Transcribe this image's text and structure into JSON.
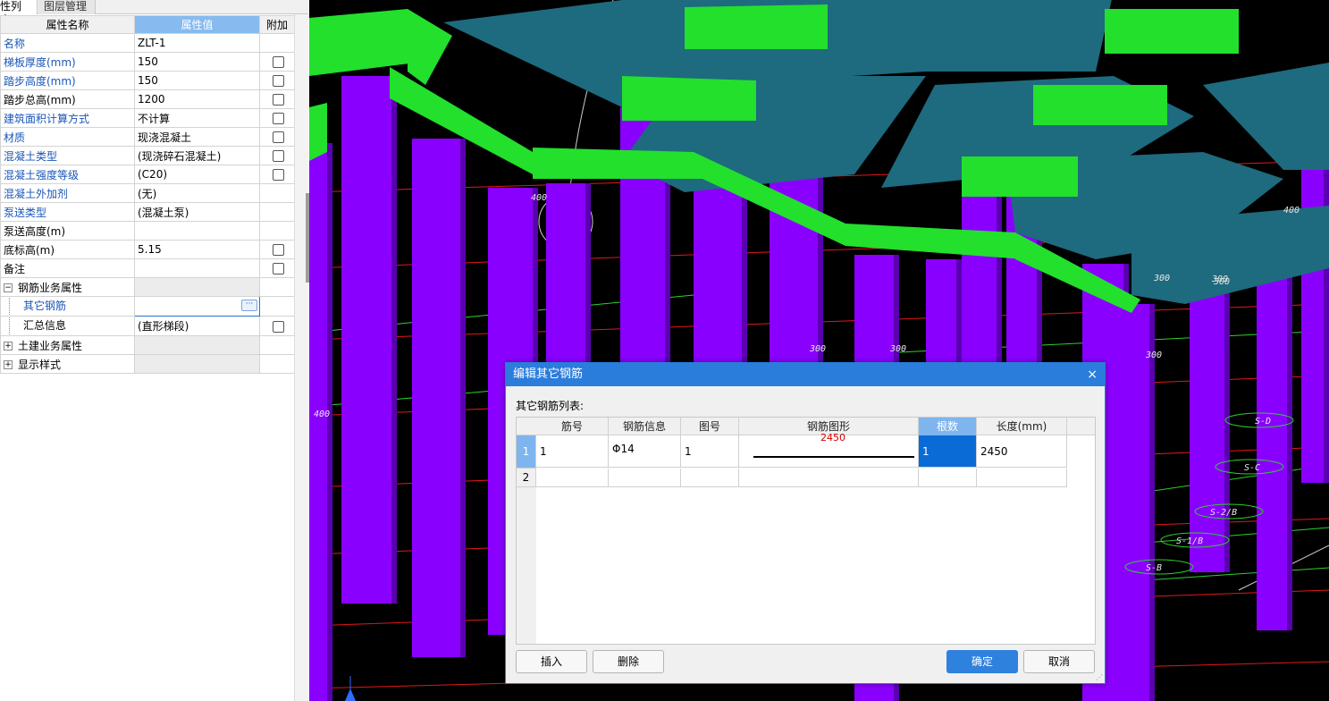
{
  "panel": {
    "tabs": [
      "性列表",
      "图层管理"
    ],
    "header": {
      "name": "属性名称",
      "value": "属性值",
      "extra": "附加"
    },
    "rows": [
      {
        "name": "名称",
        "value": "ZLT-1",
        "blue": true,
        "check": false
      },
      {
        "name": "梯板厚度(mm)",
        "value": "150",
        "blue": true,
        "check": true
      },
      {
        "name": "踏步高度(mm)",
        "value": "150",
        "blue": true,
        "check": true
      },
      {
        "name": "踏步总高(mm)",
        "value": "1200",
        "blue": false,
        "check": true
      },
      {
        "name": "建筑面积计算方式",
        "value": "不计算",
        "blue": true,
        "check": true
      },
      {
        "name": "材质",
        "value": "现浇混凝土",
        "blue": true,
        "check": true
      },
      {
        "name": "混凝土类型",
        "value": "(现浇碎石混凝土)",
        "blue": true,
        "check": true
      },
      {
        "name": "混凝土强度等级",
        "value": "(C20)",
        "blue": true,
        "check": true
      },
      {
        "name": "混凝土外加剂",
        "value": "(无)",
        "blue": true,
        "check": false
      },
      {
        "name": "泵送类型",
        "value": "(混凝土泵)",
        "blue": true,
        "check": false
      },
      {
        "name": "泵送高度(m)",
        "value": "",
        "blue": false,
        "check": false
      },
      {
        "name": "底标高(m)",
        "value": "5.15",
        "blue": false,
        "check": true
      },
      {
        "name": "备注",
        "value": "",
        "blue": false,
        "check": true
      }
    ],
    "groups": {
      "rebar": {
        "label": "钢筋业务属性",
        "toggle": "−"
      },
      "other_rebar": {
        "label": "其它钢筋",
        "value": "",
        "button": "···"
      },
      "summary": {
        "label": "汇总信息",
        "value": "(直形梯段)"
      },
      "civil": {
        "label": "土建业务属性",
        "toggle": "+"
      },
      "display": {
        "label": "显示样式",
        "toggle": "+"
      }
    }
  },
  "dialog": {
    "title": "编辑其它钢筋",
    "close": "×",
    "list_label": "其它钢筋列表:",
    "columns": [
      "筋号",
      "钢筋信息",
      "图号",
      "钢筋图形",
      "根数",
      "长度(mm)"
    ],
    "rows": [
      {
        "index": "1",
        "bar_no": "1",
        "info": "Φ14",
        "fig_no": "1",
        "shape_value": "2450",
        "count": "1",
        "length": "2450"
      },
      {
        "index": "2",
        "bar_no": "",
        "info": "",
        "fig_no": "",
        "shape_value": "",
        "count": "",
        "length": ""
      }
    ],
    "buttons": {
      "insert": "插入",
      "delete": "删除",
      "ok": "确定",
      "cancel": "取消"
    }
  },
  "viewport": {
    "labels": [
      "400",
      "400",
      "300",
      "300",
      "300",
      "300",
      "300",
      "400",
      "300",
      "S-D",
      "S-C",
      "S-2/B",
      "S-1/B",
      "S-B"
    ],
    "colors": {
      "column": "#8a00ff",
      "beam": "#22e02c",
      "slab": "#1e6a7e",
      "background": "#000000"
    }
  }
}
